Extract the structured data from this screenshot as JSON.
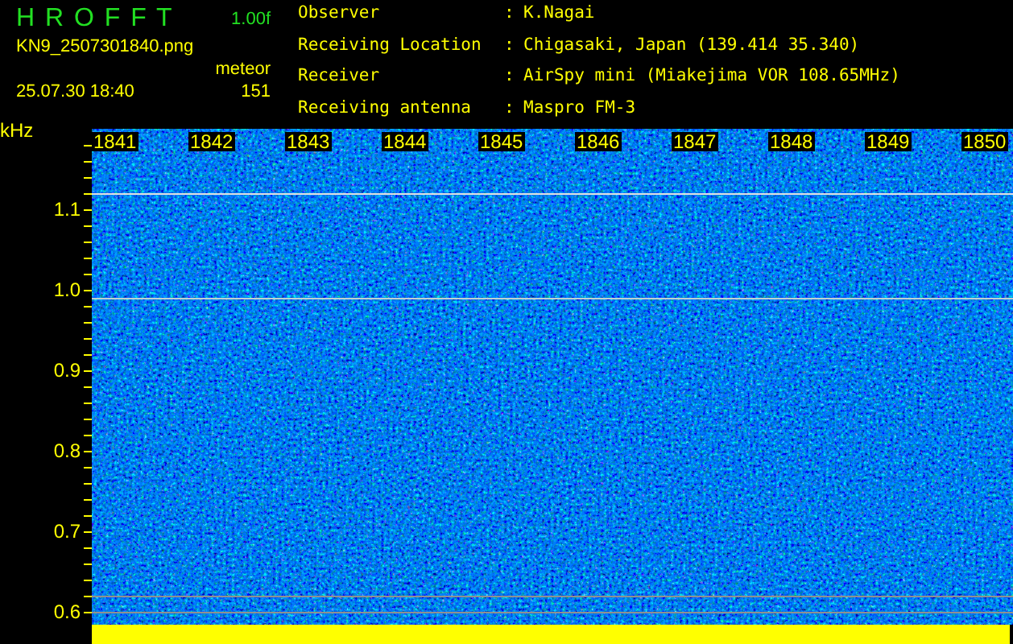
{
  "title": "H R O F F T",
  "version": "1.00f",
  "filename": "KN9_2507301840.png",
  "mode": "meteor",
  "timestamp": "25.07.30 18:40",
  "count": "151",
  "info": [
    {
      "label": "Observer",
      "separator": ":",
      "value": "K.Nagai"
    },
    {
      "label": "Receiving Location",
      "separator": ":",
      "value": "Chigasaki, Japan (139.414 35.340)"
    },
    {
      "label": "Receiver",
      "separator": ":",
      "value": "AirSpy mini (Miakejima VOR 108.65MHz)"
    },
    {
      "label": "Receiving antenna",
      "separator": ":",
      "value": "Maspro FM-3"
    }
  ],
  "axis_unit": "kHz",
  "y_labels": [
    "1.1",
    "1.0",
    "0.9",
    "0.8",
    "0.7",
    "0.6"
  ],
  "x_labels": [
    "1841",
    "1842",
    "1843",
    "1844",
    "1845",
    "1846",
    "1847",
    "1848",
    "1849",
    "1850"
  ]
}
